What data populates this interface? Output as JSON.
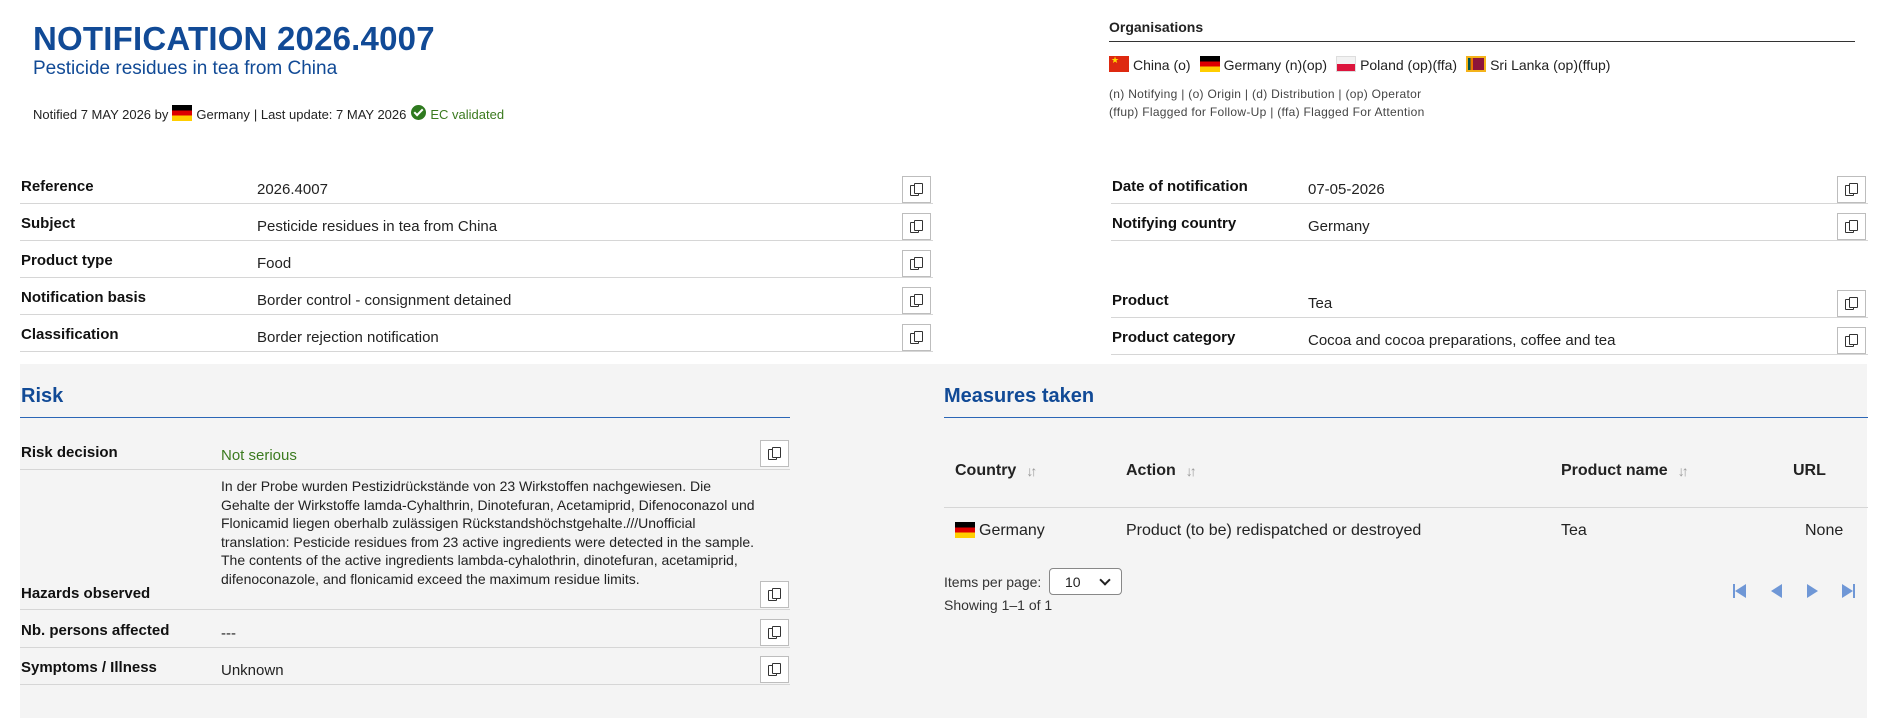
{
  "header": {
    "title": "NOTIFICATION 2026.4007",
    "subtitle": "Pesticide residues in tea from China",
    "notified_prefix": "Notified 7 MAY 2026 by",
    "notified_country": "Germany",
    "last_update": "| Last update: 7 MAY 2026",
    "validation": "EC validated"
  },
  "organisations": {
    "title": "Organisations",
    "items": [
      {
        "flag": "cn",
        "label": "China (o)"
      },
      {
        "flag": "de",
        "label": "Germany (n)(op)"
      },
      {
        "flag": "pl",
        "label": "Poland (op)(ffa)"
      },
      {
        "flag": "lk",
        "label": "Sri Lanka (op)(ffup)"
      }
    ],
    "legend_line1": "(n) Notifying | (o) Origin | (d) Distribution | (op) Operator",
    "legend_line2": "(ffup) Flagged for Follow-Up | (ffa) Flagged For Attention"
  },
  "details_left": [
    {
      "label": "Reference",
      "value": "2026.4007"
    },
    {
      "label": "Subject",
      "value": "Pesticide residues in tea from China"
    },
    {
      "label": "Product type",
      "value": "Food"
    },
    {
      "label": "Notification basis",
      "value": "Border control - consignment detained"
    },
    {
      "label": "Classification",
      "value": "Border rejection notification"
    }
  ],
  "details_right": [
    {
      "label": "Date of notification",
      "value": "07-05-2026"
    },
    {
      "label": "Notifying country",
      "value": "Germany"
    },
    {
      "label": "Product",
      "value": "Tea"
    },
    {
      "label": "Product category",
      "value": "Cocoa and cocoa preparations, coffee and tea"
    }
  ],
  "risk": {
    "title": "Risk",
    "decision_label": "Risk decision",
    "decision_value": "Not serious",
    "decision_color": "#3b7a1f",
    "hazards_label": "Hazards observed",
    "hazards_value": "In der Probe wurden Pestizidrückstände von 23 Wirkstoffen nachgewiesen. Die Gehalte der Wirkstoffe lamda-Cyhalthrin, Dinotefuran, Acetamiprid, Difenoconazol und Flonicamid liegen oberhalb zulässigen Rückstandshöchstgehalte.///Unofficial translation: Pesticide residues from 23 active ingredients were detected in the sample. The contents of the active ingredients lambda-cyhalothrin, dinotefuran, acetamiprid, difenoconazole, and flonicamid exceed the maximum residue limits.",
    "persons_label": "Nb. persons affected",
    "persons_value": "---",
    "symptoms_label": "Symptoms / Illness",
    "symptoms_value": "Unknown"
  },
  "measures": {
    "title": "Measures taken",
    "columns": [
      "Country",
      "Action",
      "Product name",
      "URL"
    ],
    "rows": [
      {
        "country": "Germany",
        "action": "Product (to be) redispatched or destroyed",
        "product": "Tea",
        "url": "None"
      }
    ],
    "items_per_page_label": "Items per page:",
    "items_per_page_value": "10",
    "showing": "Showing 1–1 of 1"
  },
  "colors": {
    "brand_blue": "#114a96",
    "accent_line": "#2b66b6",
    "pager_icon": "#6f97d6",
    "panel_bg": "#f4f4f4"
  }
}
